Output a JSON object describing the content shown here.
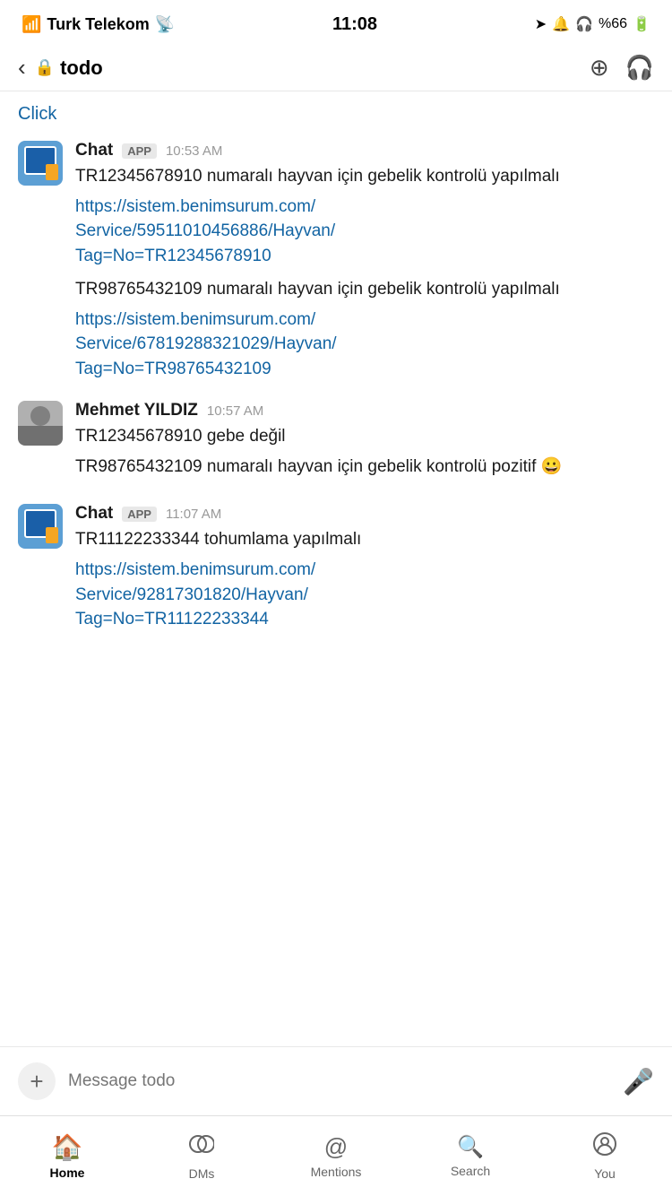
{
  "statusBar": {
    "carrier": "Turk Telekom",
    "time": "11:08",
    "battery": "%66"
  },
  "header": {
    "channelName": "todo",
    "lockLabel": "🔒"
  },
  "chat": {
    "clickLink": "Click",
    "messages": [
      {
        "id": "msg1",
        "type": "app",
        "senderName": "Chat",
        "badgeLabel": "APP",
        "timestamp": "10:53 AM",
        "bodyBlocks": [
          {
            "type": "text",
            "content": "TR12345678910 numaralı hayvan için gebelik kontrolü yapılmalı"
          },
          {
            "type": "link",
            "content": "https://sistem.benimsurum.com/Service/59511010456886/Hayvan/Tag=No=TR12345678910"
          },
          {
            "type": "text",
            "content": "TR98765432109 numaralı hayvan için gebelik kontrolü yapılmalı"
          },
          {
            "type": "link",
            "content": "https://sistem.benimsurum.com/Service/67819288321029/Hayvan/Tag=No=TR98765432109"
          }
        ]
      },
      {
        "id": "msg2",
        "type": "person",
        "senderName": "Mehmet YILDIZ",
        "timestamp": "10:57 AM",
        "bodyBlocks": [
          {
            "type": "text",
            "content": "TR12345678910 gebe değil"
          },
          {
            "type": "text",
            "content": "TR98765432109 numaralı hayvan için gebelik kontrolü pozitif 😀"
          }
        ]
      },
      {
        "id": "msg3",
        "type": "app",
        "senderName": "Chat",
        "badgeLabel": "APP",
        "timestamp": "11:07 AM",
        "bodyBlocks": [
          {
            "type": "text",
            "content": "TR11122233344 tohumlama yapılmalı"
          },
          {
            "type": "link",
            "content": "https://sistem.benimsurum.com/Service/92817301820/Hayvan/Tag=No=TR11122233344"
          }
        ]
      }
    ]
  },
  "inputBar": {
    "placeholder": "Message todo"
  },
  "bottomNav": {
    "items": [
      {
        "label": "Home",
        "icon": "🏠",
        "active": true
      },
      {
        "label": "DMs",
        "icon": "💬",
        "active": false
      },
      {
        "label": "Mentions",
        "icon": "@",
        "active": false
      },
      {
        "label": "Search",
        "icon": "🔍",
        "active": false
      },
      {
        "label": "You",
        "icon": "👤",
        "active": false
      }
    ]
  }
}
